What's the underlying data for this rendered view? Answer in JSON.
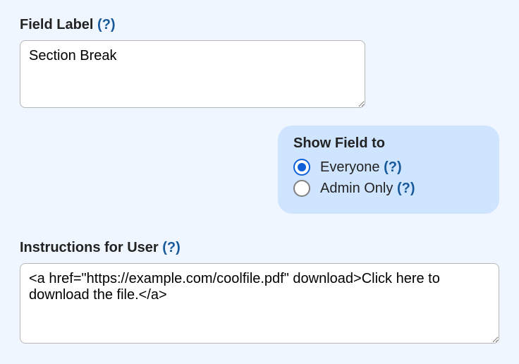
{
  "field_label": {
    "label": "Field Label",
    "help": "(?)",
    "value": "Section Break"
  },
  "show_field": {
    "title": "Show Field to",
    "options": [
      {
        "label": "Everyone",
        "help": "(?)",
        "selected": true
      },
      {
        "label": "Admin Only",
        "help": "(?)",
        "selected": false
      }
    ]
  },
  "instructions": {
    "label": "Instructions for User",
    "help": "(?)",
    "value": "<a href=\"https://example.com/coolfile.pdf\" download>Click here to download the file.</a>"
  }
}
